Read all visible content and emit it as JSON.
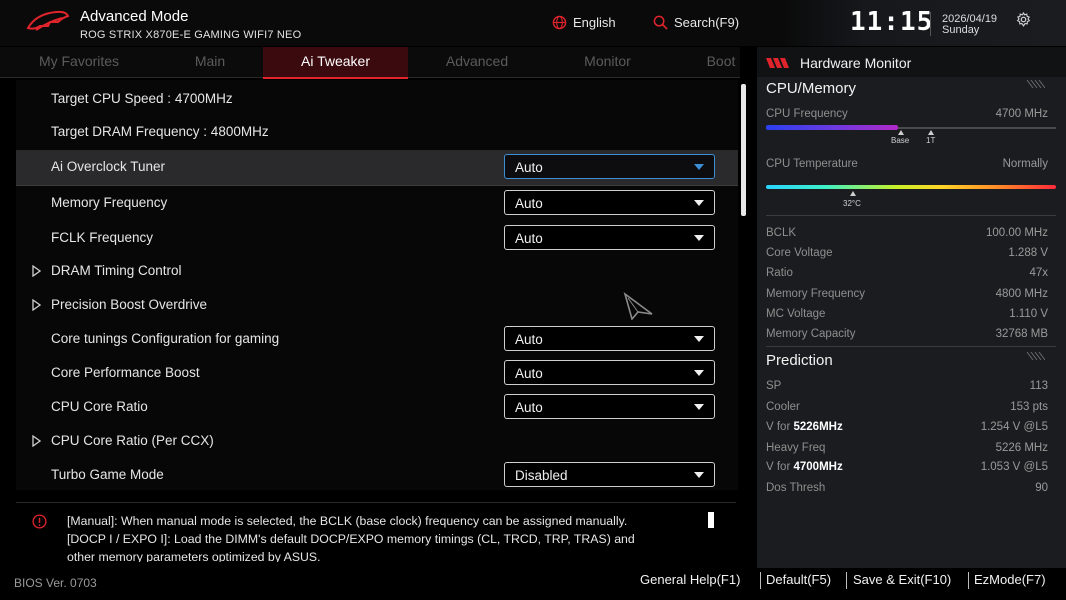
{
  "header": {
    "mode_title": "Advanced Mode",
    "model": "ROG STRIX X870E-E GAMING WIFI7 NEO",
    "language": "English",
    "search": "Search(F9)",
    "time": "11:15",
    "date": "2026/04/19",
    "weekday": "Sunday"
  },
  "tabs": [
    "My Favorites",
    "Main",
    "Ai Tweaker",
    "Advanced",
    "Monitor",
    "Boot"
  ],
  "active_tab": "Ai Tweaker",
  "settings": {
    "target_cpu_speed": "Target CPU Speed : 4700MHz",
    "target_dram_freq": "Target DRAM Frequency : 4800MHz",
    "ai_overclock_tuner": {
      "label": "Ai Overclock Tuner",
      "value": "Auto"
    },
    "memory_frequency": {
      "label": "Memory Frequency",
      "value": "Auto"
    },
    "fclk_frequency": {
      "label": "FCLK Frequency",
      "value": "Auto"
    },
    "dram_timing_control": "DRAM Timing Control",
    "precision_boost_overdrive": "Precision Boost Overdrive",
    "core_tunings": {
      "label": "Core tunings Configuration for gaming",
      "value": "Auto"
    },
    "core_performance_boost": {
      "label": "Core Performance Boost",
      "value": "Auto"
    },
    "cpu_core_ratio": {
      "label": "CPU Core Ratio",
      "value": "Auto"
    },
    "cpu_core_ratio_ccx": "CPU Core Ratio (Per CCX)",
    "turbo_game_mode": {
      "label": "Turbo Game Mode",
      "value": "Disabled"
    }
  },
  "help": {
    "line1": "[Manual]: When manual mode is selected, the BCLK (base clock) frequency can be assigned manually.",
    "line2": "[DOCP I / EXPO I]: Load the DIMM's default DOCP/EXPO memory timings (CL, TRCD, TRP, TRAS) and",
    "line3": "other memory parameters optimized by ASUS."
  },
  "footer": {
    "bios_version": "BIOS Ver. 0703",
    "general_help": "General Help(F1)",
    "default": "Default(F5)",
    "save_exit": "Save & Exit(F10)",
    "ezmode": "EzMode(F7)"
  },
  "hardware_monitor": {
    "title": "Hardware Monitor",
    "cpu_memory_title": "CPU/Memory",
    "cpu_frequency": {
      "label": "CPU Frequency",
      "value": "4700 MHz",
      "bar_fraction": 0.6
    },
    "freq_markers": {
      "base": "Base",
      "turbo": "1T"
    },
    "cpu_temperature": {
      "label": "CPU Temperature",
      "value": "Normally",
      "marker": "32°C"
    },
    "stats": [
      {
        "label": "BCLK",
        "value": "100.00 MHz"
      },
      {
        "label": "Core Voltage",
        "value": "1.288 V"
      },
      {
        "label": "Ratio",
        "value": "47x"
      },
      {
        "label": "Memory Frequency",
        "value": "4800 MHz"
      },
      {
        "label": "MC Voltage",
        "value": "1.110 V"
      },
      {
        "label": "Memory Capacity",
        "value": "32768 MB"
      }
    ],
    "prediction_title": "Prediction",
    "prediction": {
      "sp": {
        "label": "SP",
        "value": "113"
      },
      "cooler": {
        "label": "Cooler",
        "value": "153 pts"
      },
      "v_for_5226": {
        "label_prefix": "V for ",
        "label_bold": "5226MHz",
        "value": "1.254 V @L5"
      },
      "heavy_freq": {
        "label": "Heavy Freq",
        "value": "5226 MHz"
      },
      "v_for_4700": {
        "label_prefix": "V for ",
        "label_bold": "4700MHz",
        "value": "1.053 V @L5"
      },
      "dos_thresh": {
        "label": "Dos Thresh",
        "value": "90"
      }
    }
  },
  "colors": {
    "accent_red": "#e0242c",
    "focus_blue": "#3c8fd6",
    "monitor_bg": "#1b1c1f"
  }
}
